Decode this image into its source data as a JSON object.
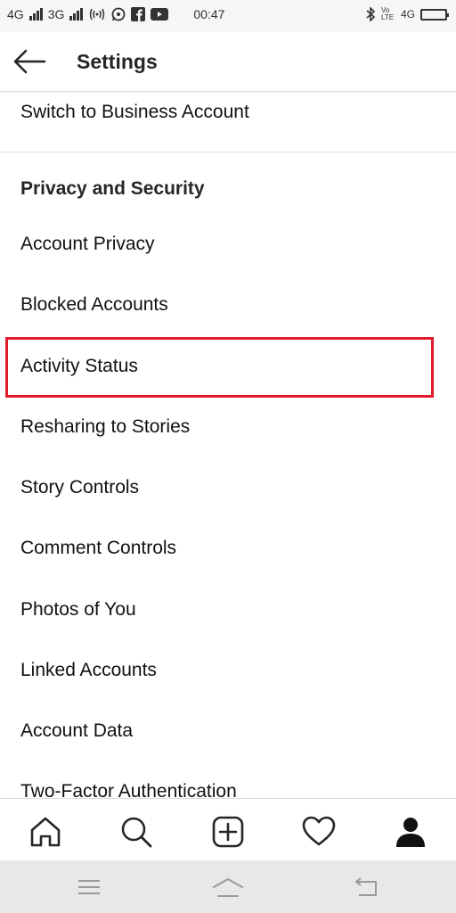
{
  "status_bar": {
    "sim1": "4G",
    "sim2": "3G",
    "time": "00:47",
    "volte": "Vo LTE",
    "network_right": "4G"
  },
  "header": {
    "title": "Settings"
  },
  "items": {
    "switch_business": "Switch to Business Account",
    "privacy_section": "Privacy and Security",
    "account_privacy": "Account Privacy",
    "blocked_accounts": "Blocked Accounts",
    "activity_status": "Activity Status",
    "resharing": "Resharing to Stories",
    "story_controls": "Story Controls",
    "comment_controls": "Comment Controls",
    "photos_of_you": "Photos of You",
    "linked_accounts": "Linked Accounts",
    "account_data": "Account Data",
    "two_factor": "Two-Factor Authentication"
  },
  "colors": {
    "highlight_border": "#e11b2b",
    "divider": "#dbdbdb",
    "text": "#111111"
  },
  "icons": {
    "tab_home": "home-icon",
    "tab_search": "search-icon",
    "tab_new_post": "add-post-icon",
    "tab_activity": "heart-icon",
    "tab_profile": "profile-icon"
  }
}
